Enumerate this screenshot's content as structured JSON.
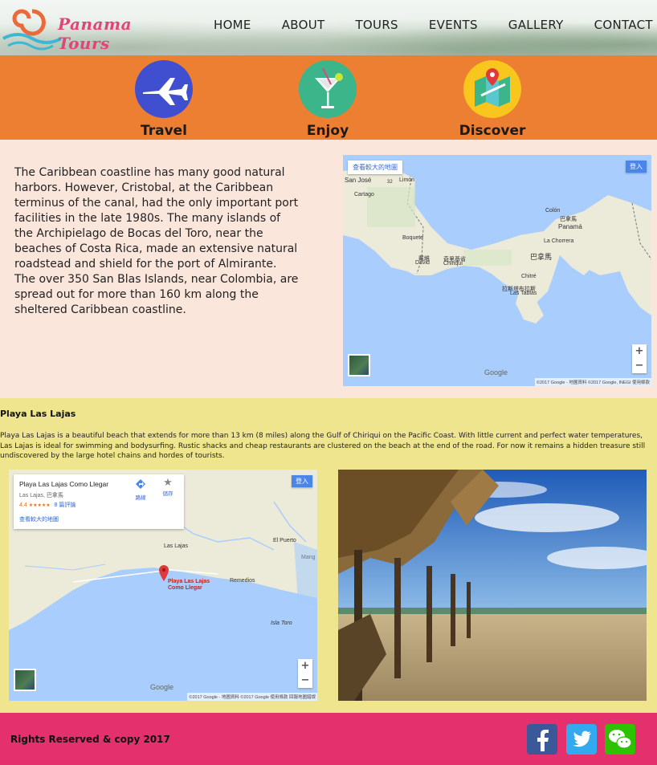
{
  "header": {
    "logo_text": "Panama Tours",
    "nav": [
      "HOME",
      "ABOUT",
      "TOURS",
      "EVENTS",
      "GALLERY",
      "CONTACT"
    ]
  },
  "features": [
    {
      "label": "Travel",
      "icon": "airplane-icon",
      "color": "#3f4fd0"
    },
    {
      "label": "Enjoy",
      "icon": "cocktail-icon",
      "color": "#3db58a"
    },
    {
      "label": "Discover",
      "icon": "map-pin-icon",
      "color": "#f8c61c"
    }
  ],
  "intro": {
    "text": "The Caribbean coastline has many good natural harbors. However, Cristobal, at the Caribbean terminus of the canal, had the only important port facilities in the late 1980s. The many islands of the Archipielago de Bocas del Toro, near the beaches of Costa Rica, made an extensive natural roadstead and shield for the port of Almirante. The over 350 San Blas Islands, near Colombia, are spread out for more than 160 km along the sheltered Caribbean coastline."
  },
  "map1": {
    "larger_map": "查看較大的地圖",
    "sign_in": "登入",
    "labels": {
      "san_jose": "San José",
      "cartago": "Cartago",
      "limon": "Limón",
      "colon": "Colón",
      "colon_zh": "巴拿馬",
      "panama": "Panamá",
      "la_chorrera": "La Chorrera",
      "boquete": "Boquete",
      "david_zh": "戴維",
      "david": "David",
      "chiriqui_zh": "奇里基省",
      "chiriqui": "Chiriquí",
      "panama_zh": "巴拿馬",
      "chitre": "Chitré",
      "las_tablas_zh": "拉斯塔布拉斯",
      "las_tablas": "Las Tablas",
      "route": "32",
      "route2": "36"
    },
    "zoom_in": "+",
    "zoom_out": "−",
    "google": "Google",
    "attribution": "©2017 Google - 地圖資料 ©2017 Google, INEGI   使用條款"
  },
  "beach": {
    "title": "Playa Las Lajas",
    "desc": "Playa Las Lajas is a beautiful beach that extends for more than 13 km (8 miles) along the Gulf of Chiriqui on the Pacific Coast. With little current and perfect water temperatures, Las Lajas is ideal for swimming and bodysurfing. Rustic shacks and cheap restaurants are clustered on the beach at the end of the road. For now it remains a hidden treasure still undiscovered by the large hotel chains and hordes of tourists."
  },
  "map2": {
    "place_name": "Playa Las Lajas Como Llegar",
    "place_sub": "Las Lajas, 巴拿馬",
    "rating": "4.4",
    "stars": "★★★★★",
    "reviews": "8 篇評論",
    "directions": "路線",
    "save": "儲存",
    "larger_map": "查看較大的地圖",
    "sign_in": "登入",
    "labels": {
      "las_lajas": "Las Lajas",
      "el_puerto": "El Puerto",
      "remedios": "Remedios",
      "isla_toro": "Isla Toro",
      "mang": "Mang",
      "pin_label_1": "Playa Las Lajas",
      "pin_label_2": "Como Llegar"
    },
    "zoom_in": "+",
    "zoom_out": "−",
    "google": "Google",
    "attribution": "©2017 Google - 地圖資料 ©2017 Google   使用條款   回報地圖錯誤"
  },
  "footer": {
    "copyright": "Rights Reserved & copy 2017",
    "social": [
      {
        "icon": "facebook-icon",
        "color": "#3b5998"
      },
      {
        "icon": "twitter-icon",
        "color": "#33aaf0"
      },
      {
        "icon": "wechat-icon",
        "color": "#2dc100"
      }
    ]
  }
}
